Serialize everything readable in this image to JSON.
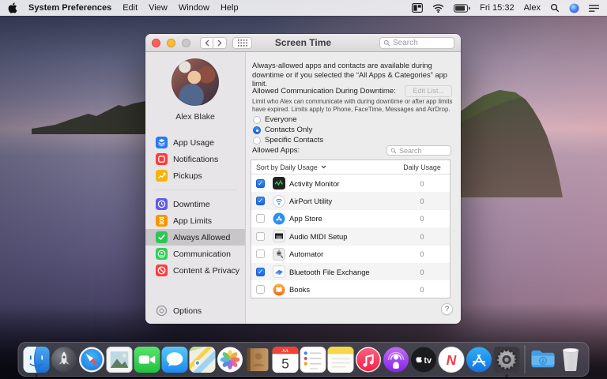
{
  "menu_bar": {
    "menus": [
      "System Preferences",
      "Edit",
      "View",
      "Window",
      "Help"
    ],
    "clock": "Fri 15:32",
    "user": "Alex"
  },
  "window": {
    "title": "Screen Time",
    "titlebar_search_placeholder": "Search",
    "sidebar": {
      "user_name": "Alex Blake",
      "groups": [
        [
          {
            "label": "App Usage",
            "icon": "app-usage",
            "color": "#2779f6"
          },
          {
            "label": "Notifications",
            "icon": "notifications",
            "color": "#fc3d39"
          },
          {
            "label": "Pickups",
            "icon": "pickups",
            "color": "#f7b500"
          }
        ],
        [
          {
            "label": "Downtime",
            "icon": "downtime",
            "color": "#5e5ce6"
          },
          {
            "label": "App Limits",
            "icon": "app-limits",
            "color": "#f79400"
          },
          {
            "label": "Always Allowed",
            "icon": "always-allowed",
            "color": "#2dc653",
            "selected": true
          },
          {
            "label": "Communication",
            "icon": "communication",
            "color": "#31d158"
          },
          {
            "label": "Content & Privacy",
            "icon": "content-privacy",
            "color": "#fc3d39"
          }
        ]
      ],
      "options_label": "Options"
    },
    "content": {
      "intro": "Always-allowed apps and contacts are available during downtime or if you selected the “All Apps & Categories” app limit.",
      "communication_label": "Allowed Communication During Downtime:",
      "edit_list_button": "Edit List...",
      "communication_description": "Limit who Alex can communicate with during downtime or after app limits have expired. Limits apply to Phone, FaceTime, Messages and AirDrop.",
      "radio_options": [
        {
          "label": "Everyone",
          "selected": false
        },
        {
          "label": "Contacts Only",
          "selected": true
        },
        {
          "label": "Specific Contacts",
          "selected": false
        }
      ],
      "allowed_apps_label": "Allowed Apps:",
      "apps_search_placeholder": "Search",
      "table": {
        "sort_label": "Sort by Daily Usage",
        "usage_column_header": "Daily Usage",
        "rows": [
          {
            "app": "Activity Monitor",
            "icon": "activity-monitor",
            "checked": true,
            "usage": "0"
          },
          {
            "app": "AirPort Utility",
            "icon": "airport-utility",
            "checked": true,
            "usage": "0"
          },
          {
            "app": "App Store",
            "icon": "app-store",
            "checked": false,
            "usage": "0"
          },
          {
            "app": "Audio MIDI Setup",
            "icon": "audio-midi-setup",
            "checked": false,
            "usage": "0"
          },
          {
            "app": "Automator",
            "icon": "automator",
            "checked": false,
            "usage": "0"
          },
          {
            "app": "Bluetooth File Exchange",
            "icon": "bluetooth-file-exchange",
            "checked": true,
            "usage": "0"
          },
          {
            "app": "Books",
            "icon": "books",
            "checked": false,
            "usage": "0"
          }
        ]
      },
      "help_button": "?"
    }
  },
  "dock": {
    "calendar_day": "5",
    "items": [
      {
        "name": "finder",
        "running": true
      },
      {
        "name": "launchpad"
      },
      {
        "name": "safari"
      },
      {
        "name": "preview"
      },
      {
        "name": "facetime"
      },
      {
        "name": "messages"
      },
      {
        "name": "maps"
      },
      {
        "name": "photos"
      },
      {
        "name": "contacts"
      },
      {
        "name": "calendar"
      },
      {
        "name": "reminders"
      },
      {
        "name": "notes"
      },
      {
        "name": "music"
      },
      {
        "name": "podcasts"
      },
      {
        "name": "tv"
      },
      {
        "name": "news"
      },
      {
        "name": "app-store"
      },
      {
        "name": "system-preferences",
        "running": true,
        "active": true
      },
      {
        "name": "separator"
      },
      {
        "name": "downloads"
      },
      {
        "name": "trash"
      }
    ]
  },
  "colors": {
    "accent_blue": "#1e6ee8",
    "sidebar_selected": "#c8c6c8",
    "menu_bar_bg": "#f7f7fa",
    "window_bg": "#ececec"
  }
}
